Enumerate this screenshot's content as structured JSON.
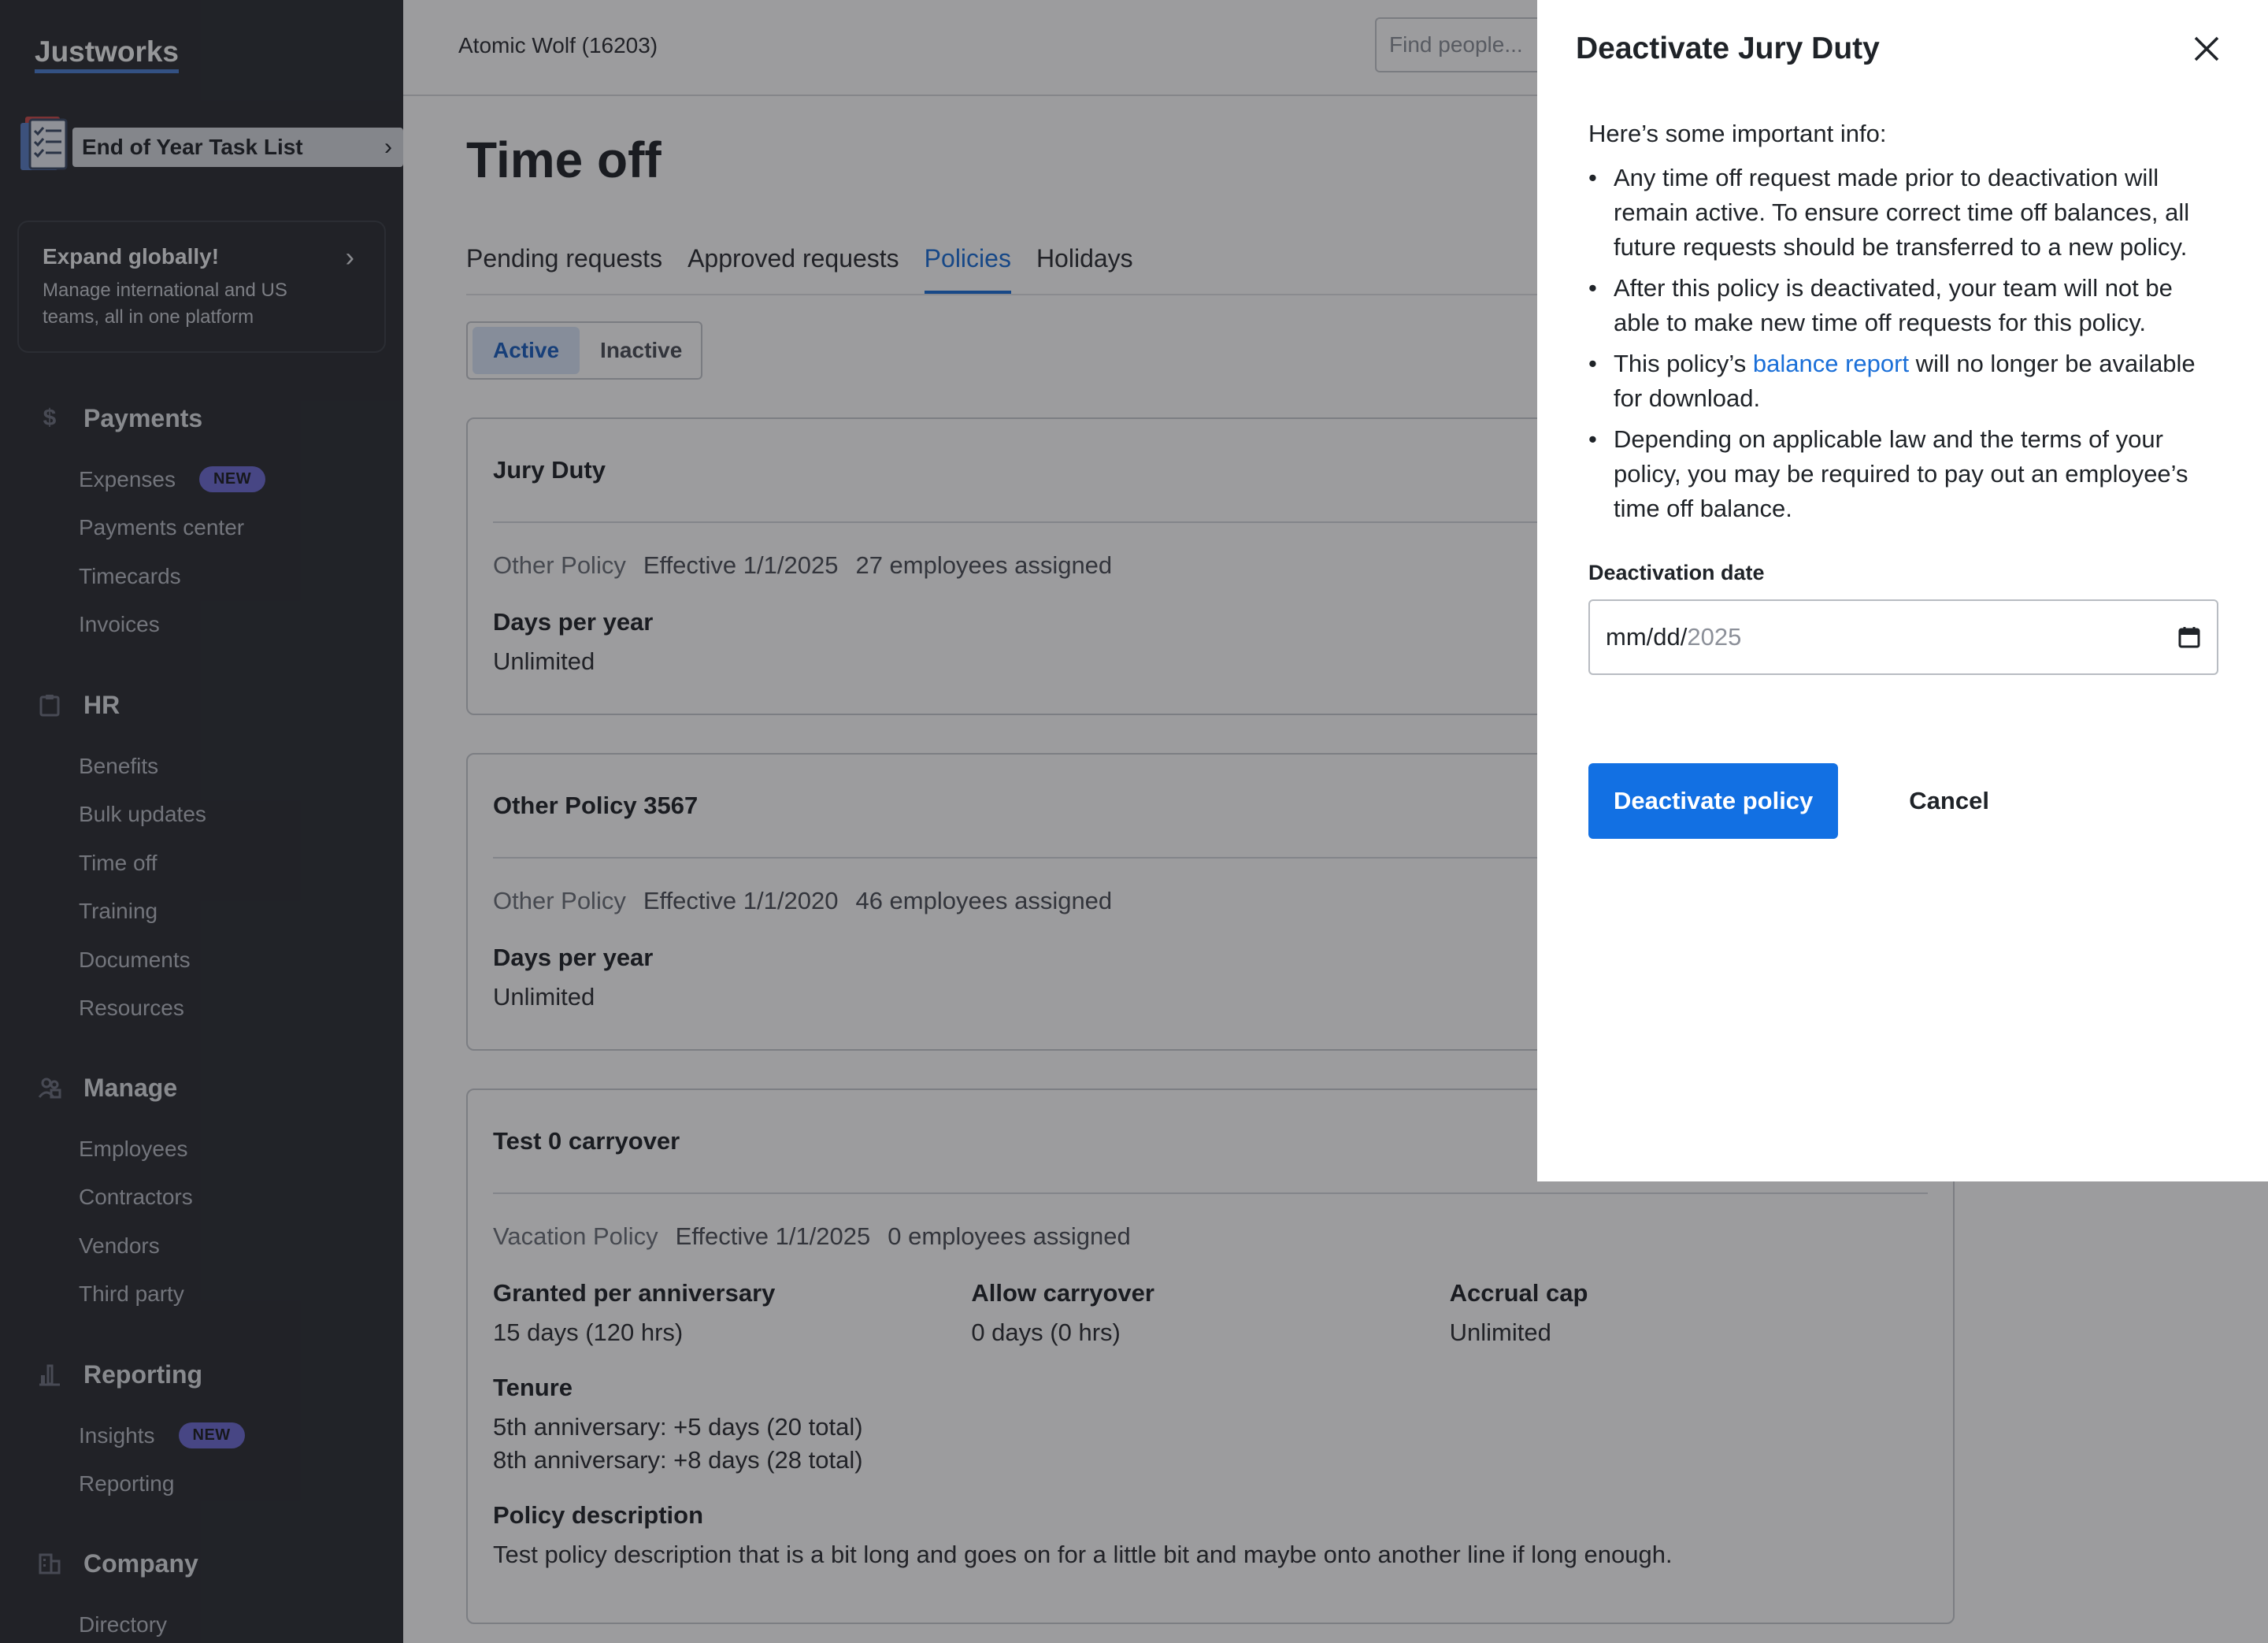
{
  "sidebar": {
    "logo": "Justworks",
    "task_banner": "End of Year Task List",
    "expand_card": {
      "title": "Expand globally!",
      "description": "Manage international and US teams, all in one platform"
    },
    "sections": [
      {
        "label": "Payments",
        "icon": "dollar-icon",
        "items": [
          {
            "label": "Expenses",
            "badge": "NEW"
          },
          {
            "label": "Payments center"
          },
          {
            "label": "Timecards"
          },
          {
            "label": "Invoices"
          }
        ]
      },
      {
        "label": "HR",
        "icon": "clipboard-icon",
        "items": [
          {
            "label": "Benefits"
          },
          {
            "label": "Bulk updates"
          },
          {
            "label": "Time off"
          },
          {
            "label": "Training"
          },
          {
            "label": "Documents"
          },
          {
            "label": "Resources"
          }
        ]
      },
      {
        "label": "Manage",
        "icon": "people-icon",
        "items": [
          {
            "label": "Employees"
          },
          {
            "label": "Contractors"
          },
          {
            "label": "Vendors"
          },
          {
            "label": "Third party"
          }
        ]
      },
      {
        "label": "Reporting",
        "icon": "bar-chart-icon",
        "items": [
          {
            "label": "Insights",
            "badge": "NEW"
          },
          {
            "label": "Reporting"
          }
        ]
      },
      {
        "label": "Company",
        "icon": "building-icon",
        "items": [
          {
            "label": "Directory"
          }
        ]
      }
    ]
  },
  "header": {
    "company": "Atomic Wolf (16203)",
    "search_placeholder": "Find people..."
  },
  "page": {
    "title": "Time off",
    "tabs": [
      "Pending requests",
      "Approved requests",
      "Policies",
      "Holidays"
    ],
    "active_tab": "Policies",
    "segment": {
      "active": "Active",
      "inactive": "Inactive"
    }
  },
  "policies": [
    {
      "name": "Jury Duty",
      "type": "Other Policy",
      "effective": "Effective 1/1/2025",
      "assigned": "27 employees assigned",
      "fields": [
        {
          "label": "Days per year",
          "value": "Unlimited"
        }
      ]
    },
    {
      "name": "Other Policy 3567",
      "type": "Other Policy",
      "effective": "Effective 1/1/2020",
      "assigned": "46 employees assigned",
      "fields": [
        {
          "label": "Days per year",
          "value": "Unlimited"
        }
      ]
    },
    {
      "name": "Test 0 carryover",
      "type": "Vacation Policy",
      "effective": "Effective 1/1/2025",
      "assigned": "0 employees assigned",
      "fields": [
        {
          "label": "Granted per anniversary",
          "value": "15 days (120 hrs)"
        },
        {
          "label": "Allow carryover",
          "value": "0 days (0 hrs)"
        },
        {
          "label": "Accrual cap",
          "value": "Unlimited"
        }
      ],
      "tenure_label": "Tenure",
      "tenure": [
        "5th anniversary: +5 days (20 total)",
        "8th anniversary: +8 days (28 total)"
      ],
      "description_label": "Policy description",
      "description": "Test policy description that is a bit long and goes on for a little bit and maybe onto another line if long enough."
    }
  ],
  "modal": {
    "title": "Deactivate Jury Duty",
    "intro": "Here’s some important info:",
    "bullets": [
      "Any time off request made prior to deactivation will remain active. To ensure correct time off balances, all future requests should be transferred to a new policy.",
      "After this policy is deactivated, your team will not be able to make new time off requests for this policy."
    ],
    "bullet3_prefix": "This policy’s ",
    "bullet3_link": "balance report",
    "bullet3_suffix": " will no longer be available for download.",
    "bullet4": "Depending on applicable law and the terms of your policy, you may be required to pay out an employee’s time off balance.",
    "date_label": "Deactivation date",
    "date_fixed": "mm/dd/",
    "date_year": "2025",
    "primary_button": "Deactivate policy",
    "cancel_button": "Cancel"
  },
  "colors": {
    "sidebar_bg": "#2b2e33",
    "accent": "#1270e3",
    "badge": "#6d6bd3"
  }
}
